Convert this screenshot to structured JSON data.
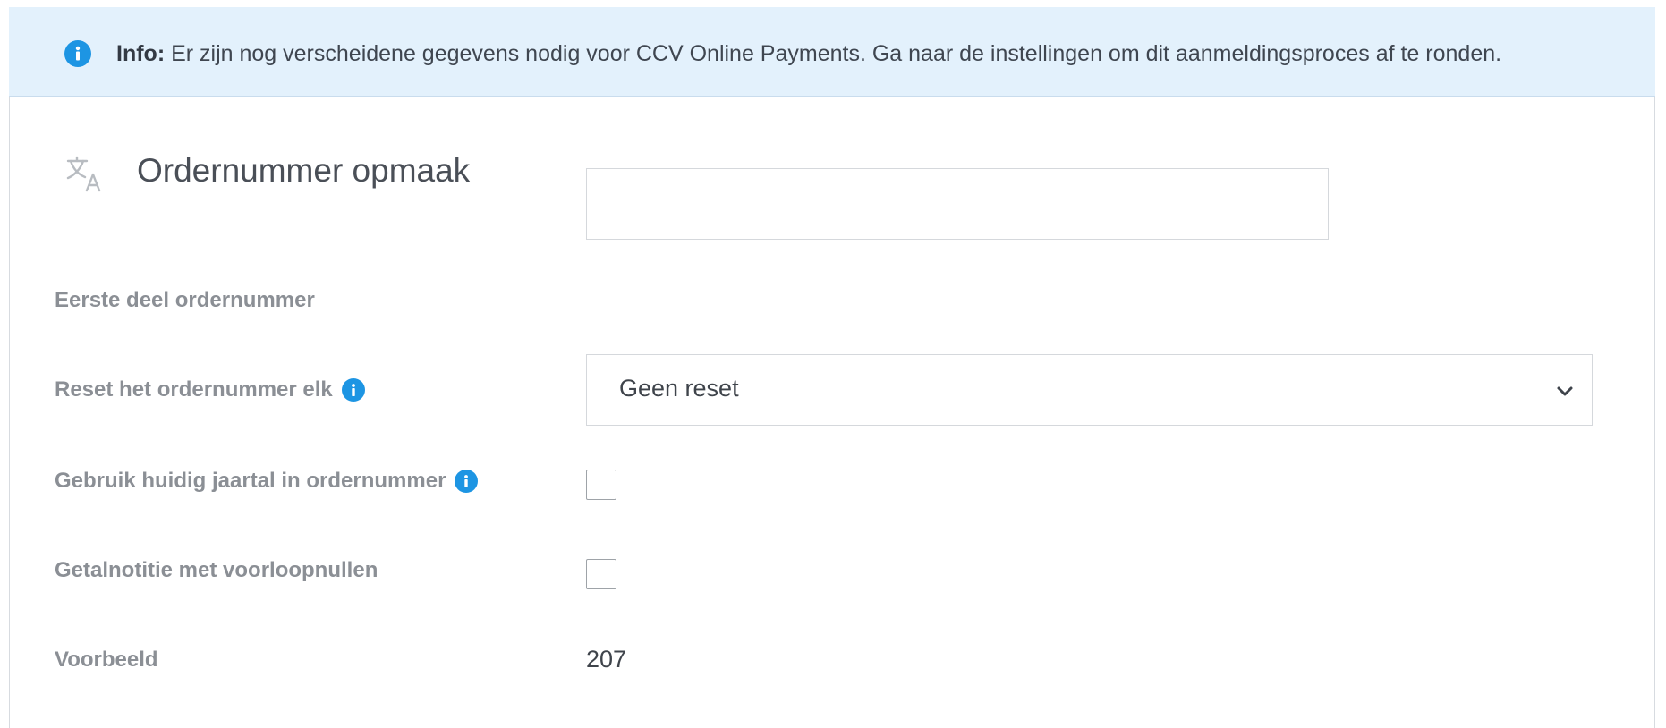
{
  "info_banner": {
    "label": "Info:",
    "message": "Er zijn nog verscheidene gegevens nodig voor CCV Online Payments. Ga naar de instellingen om dit aanmeldingsproces af te ronden.",
    "icon": "info-icon",
    "accent": "#1d95e3",
    "background": "#e3f1fc"
  },
  "panel": {
    "icon": "translate-icon",
    "title": "Ordernummer opmaak"
  },
  "fields": {
    "prefix": {
      "label": "Eerste deel ordernummer",
      "value": "",
      "placeholder": ""
    },
    "reset": {
      "label": "Reset het ordernummer elk",
      "selected": "Geen reset",
      "has_help": true
    },
    "use_year": {
      "label": "Gebruik huidig jaartal in ordernummer",
      "checked": false,
      "has_help": true
    },
    "leading_zeros": {
      "label": "Getalnotitie met voorloopnullen",
      "checked": false
    },
    "example": {
      "label": "Voorbeeld",
      "value": "207"
    }
  }
}
